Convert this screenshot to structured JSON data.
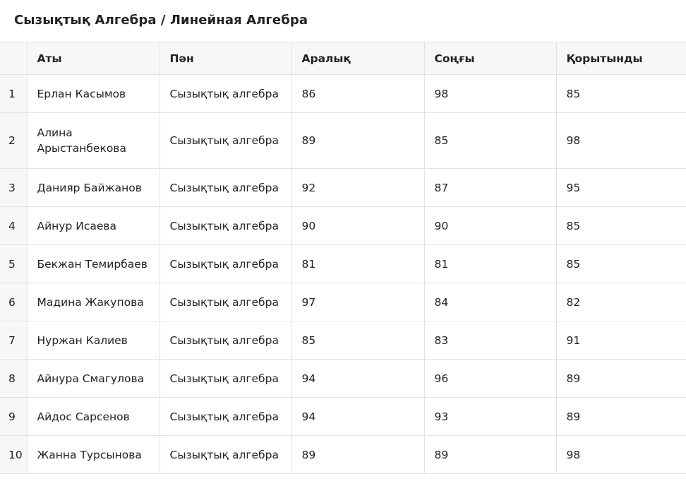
{
  "page": {
    "title": "Сызықтық Алгебра / Линейная Алгебра"
  },
  "table": {
    "headers": [
      "",
      "Аты",
      "Пән",
      "Аралық",
      "Соңғы",
      "Қорытынды"
    ],
    "rows": [
      {
        "index": "1",
        "name": "Ерлан Касымов",
        "subject": "Сызықтық алгебра",
        "midterm": "86",
        "final": "98",
        "total": "85"
      },
      {
        "index": "2",
        "name": "Алина Арыстанбекова",
        "subject": "Сызықтық алгебра",
        "midterm": "89",
        "final": "85",
        "total": "98"
      },
      {
        "index": "3",
        "name": "Данияр Байжанов",
        "subject": "Сызықтық алгебра",
        "midterm": "92",
        "final": "87",
        "total": "95"
      },
      {
        "index": "4",
        "name": "Айнур Исаева",
        "subject": "Сызықтық алгебра",
        "midterm": "90",
        "final": "90",
        "total": "85"
      },
      {
        "index": "5",
        "name": "Бекжан Темирбаев",
        "subject": "Сызықтық алгебра",
        "midterm": "81",
        "final": "81",
        "total": "85"
      },
      {
        "index": "6",
        "name": "Мадина Жакупова",
        "subject": "Сызықтық алгебра",
        "midterm": "97",
        "final": "84",
        "total": "82"
      },
      {
        "index": "7",
        "name": "Нуржан Калиев",
        "subject": "Сызықтық алгебра",
        "midterm": "85",
        "final": "83",
        "total": "91"
      },
      {
        "index": "8",
        "name": "Айнура Смагулова",
        "subject": "Сызықтық алгебра",
        "midterm": "94",
        "final": "96",
        "total": "89"
      },
      {
        "index": "9",
        "name": "Айдос Сарсенов",
        "subject": "Сызықтық алгебра",
        "midterm": "94",
        "final": "93",
        "total": "89"
      },
      {
        "index": "10",
        "name": "Жанна Турсынова",
        "subject": "Сызықтық алгебра",
        "midterm": "89",
        "final": "89",
        "total": "98"
      }
    ]
  }
}
